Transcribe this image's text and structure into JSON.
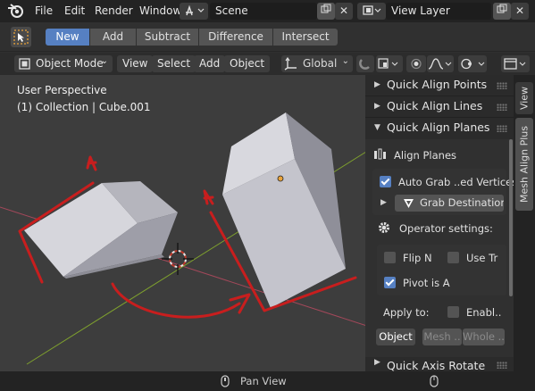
{
  "topbar": {
    "menus": [
      "File",
      "Edit",
      "Render",
      "Window"
    ],
    "scene": "Scene",
    "view_layer": "View Layer"
  },
  "tool_header": {
    "modes": [
      "New",
      "Add",
      "Subtract",
      "Difference",
      "Intersect"
    ],
    "active_mode": "New"
  },
  "view_header": {
    "mode": "Object Mode",
    "menus": [
      "View",
      "Select",
      "Add",
      "Object"
    ],
    "transform_orientation": "Global"
  },
  "viewport": {
    "perspective": "User Perspective",
    "collection": "(1) Collection | Cube.001"
  },
  "npanel": {
    "panels": [
      {
        "title": "Quick Align Points",
        "expanded": false
      },
      {
        "title": "Quick Align Lines",
        "expanded": false
      },
      {
        "title": "Quick Align Planes",
        "expanded": true
      }
    ],
    "align_planes_label": "Align Planes",
    "auto_grab_label": "Auto Grab ..ed Vertices",
    "auto_grab_checked": true,
    "grab_destination": "Grab Destination",
    "operator_settings": "Operator settings:",
    "flip_n": "Flip N",
    "flip_n_checked": false,
    "use_tr": "Use Tr",
    "use_tr_checked": false,
    "pivot_is_a": "Pivot is A",
    "pivot_is_a_checked": true,
    "apply_to": "Apply to:",
    "enable_label": "Enabl..",
    "enable_checked": false,
    "apply_buttons": [
      "Object",
      "Mesh ..",
      "Whole .."
    ],
    "active_apply": "Object",
    "bottom_panel": "Quick Axis Rotate"
  },
  "side_tabs": [
    "View",
    "Mesh Align Plus"
  ],
  "status_bar": {
    "hint": "Pan View"
  },
  "colors": {
    "accent": "#5680c2",
    "annotation": "#c81e1e",
    "x_axis": "#a3485a",
    "y_axis": "#7fa12e"
  }
}
